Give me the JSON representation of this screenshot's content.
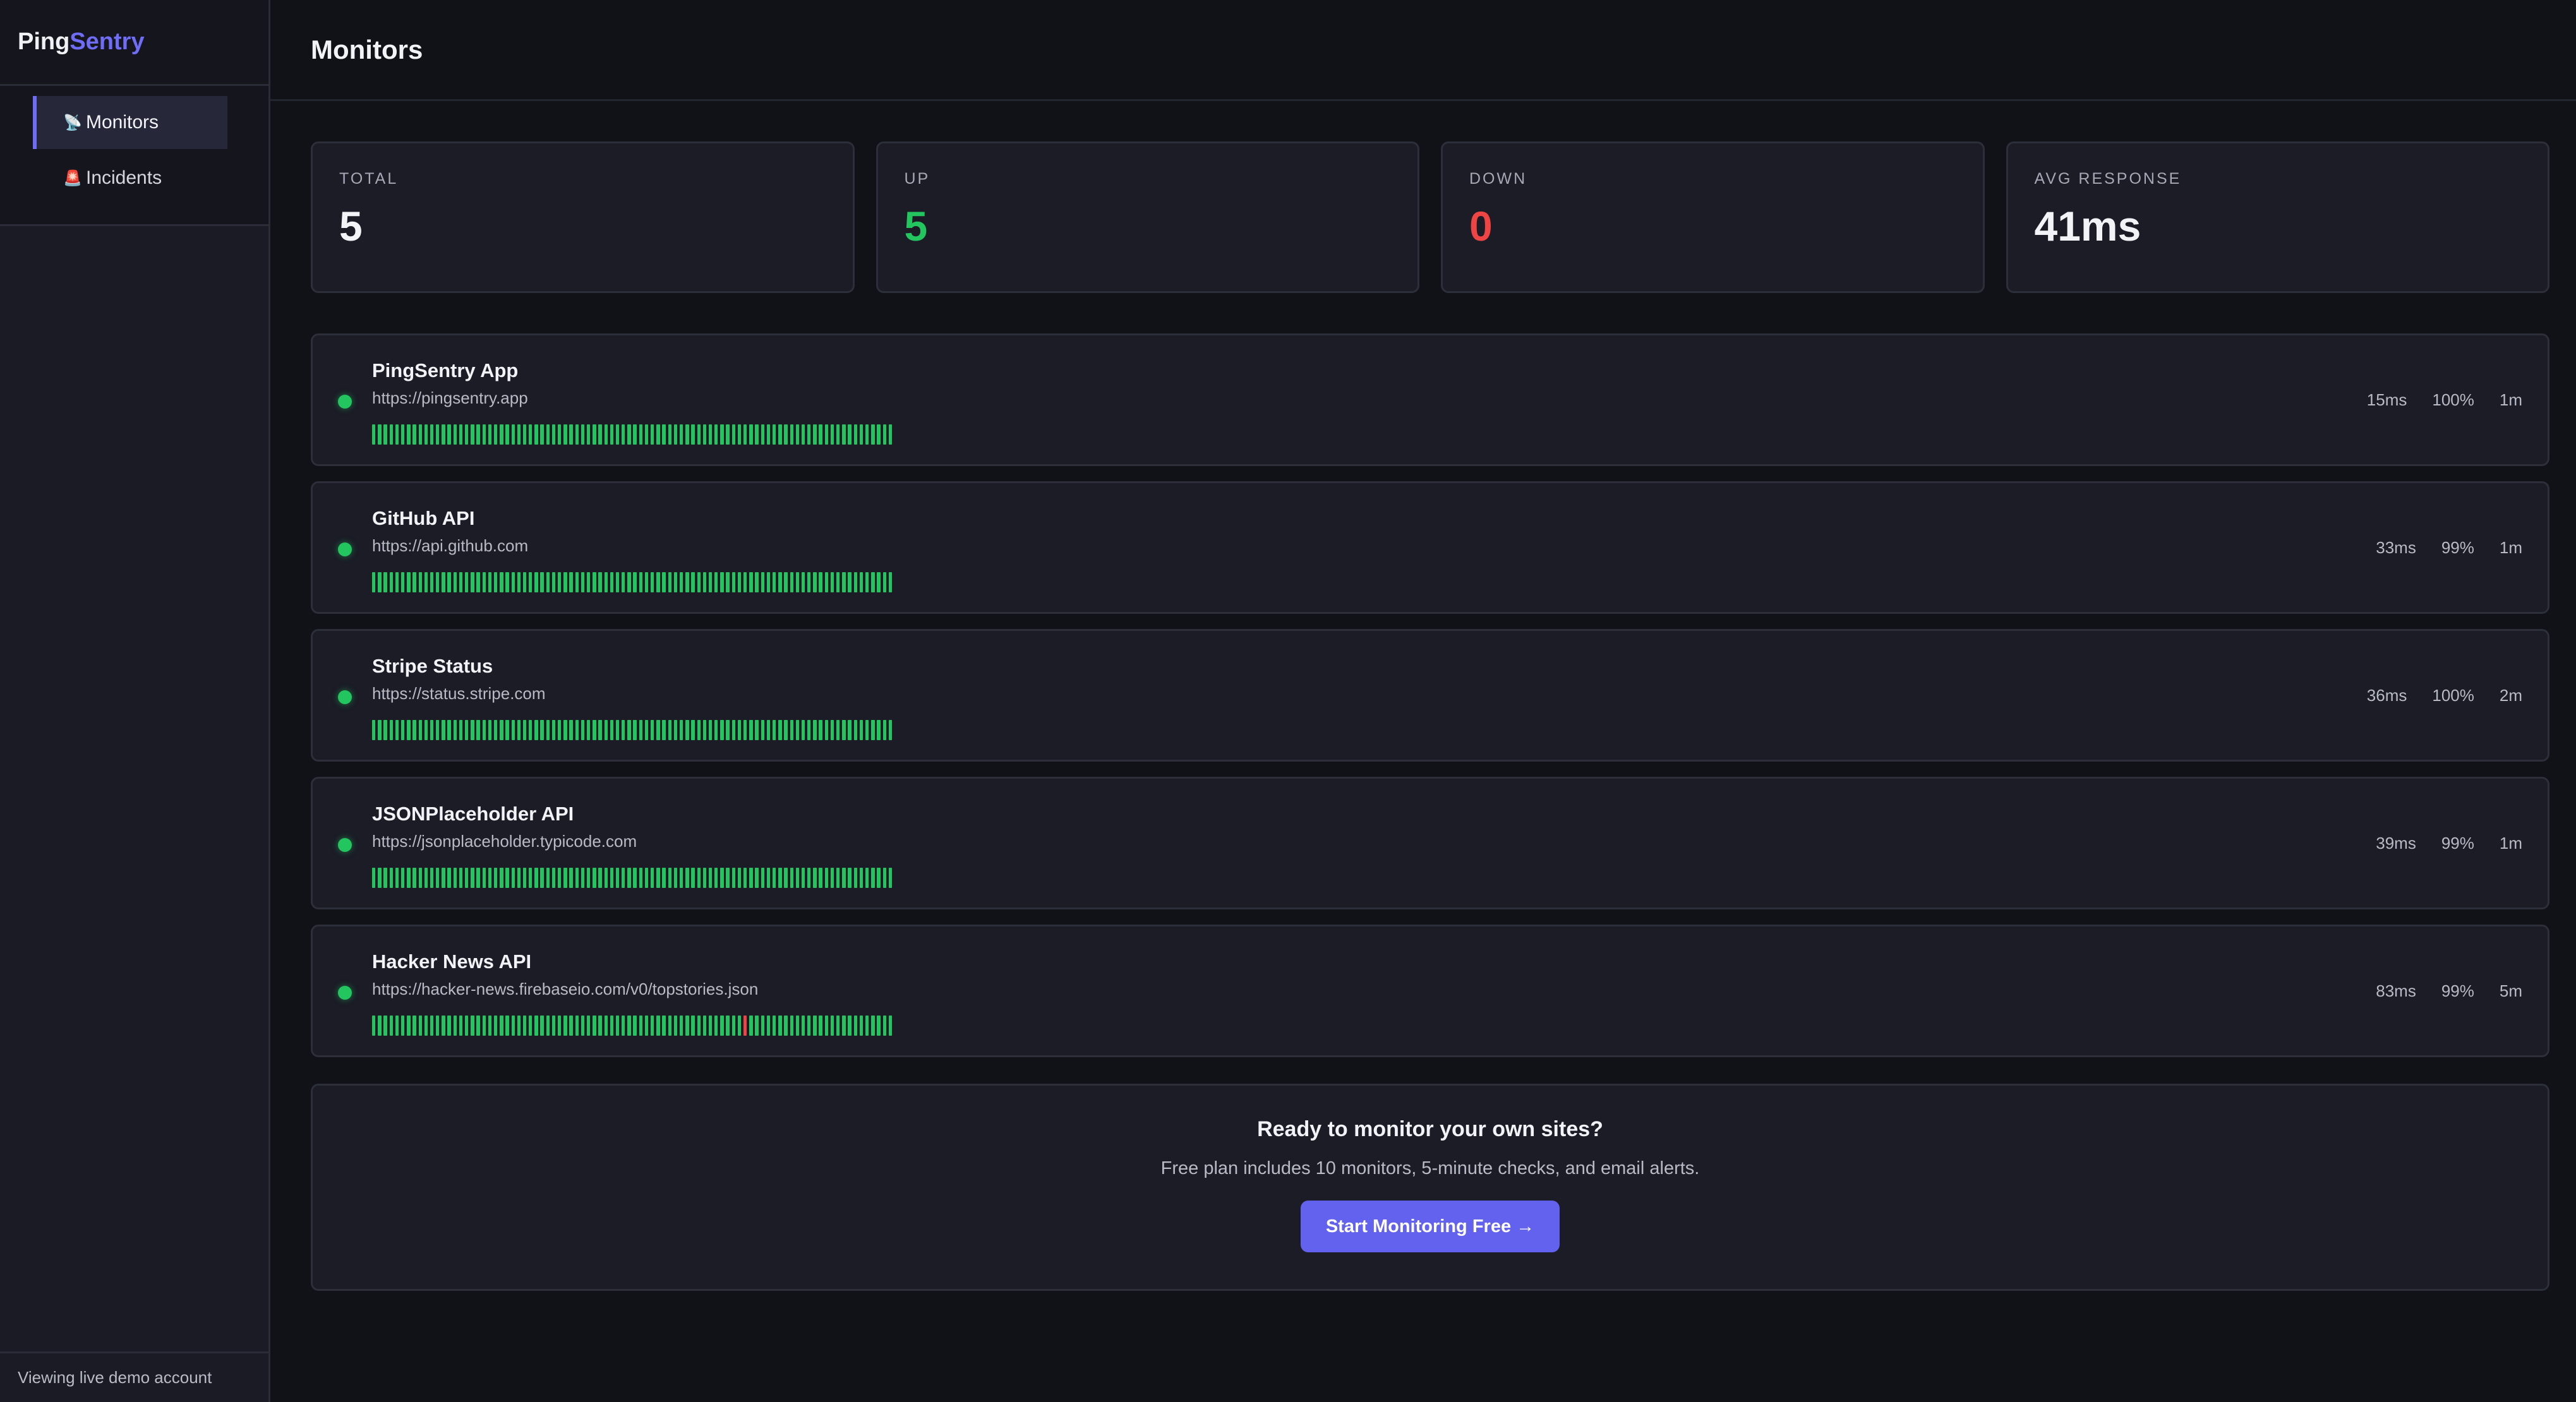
{
  "brand": {
    "part1": "Ping",
    "part2": "Sentry"
  },
  "nav": [
    {
      "icon": "📡",
      "icon_name": "satellite-antenna-icon",
      "label": "Monitors",
      "active": true
    },
    {
      "icon": "🚨",
      "icon_name": "siren-icon",
      "label": "Incidents",
      "active": false
    }
  ],
  "footer_text": "Viewing live demo account",
  "page_title": "Monitors",
  "stats": [
    {
      "label": "TOTAL",
      "value": "5",
      "tone": "default"
    },
    {
      "label": "UP",
      "value": "5",
      "tone": "green"
    },
    {
      "label": "DOWN",
      "value": "0",
      "tone": "red"
    },
    {
      "label": "AVG RESPONSE",
      "value": "41ms",
      "tone": "default"
    }
  ],
  "monitors": [
    {
      "name": "PingSentry App",
      "url": "https://pingsentry.app",
      "response": "15ms",
      "uptime": "100%",
      "interval": "1m",
      "status": "up",
      "down_checks": []
    },
    {
      "name": "GitHub API",
      "url": "https://api.github.com",
      "response": "33ms",
      "uptime": "99%",
      "interval": "1m",
      "status": "up",
      "down_checks": []
    },
    {
      "name": "Stripe Status",
      "url": "https://status.stripe.com",
      "response": "36ms",
      "uptime": "100%",
      "interval": "2m",
      "status": "up",
      "down_checks": []
    },
    {
      "name": "JSONPlaceholder API",
      "url": "https://jsonplaceholder.typicode.com",
      "response": "39ms",
      "uptime": "99%",
      "interval": "1m",
      "status": "up",
      "down_checks": []
    },
    {
      "name": "Hacker News API",
      "url": "https://hacker-news.firebaseio.com/v0/topstories.json",
      "response": "83ms",
      "uptime": "99%",
      "interval": "5m",
      "status": "up",
      "down_checks": [
        64
      ]
    }
  ],
  "checks_per_monitor": 90,
  "cta": {
    "title": "Ready to monitor your own sites?",
    "text": "Free plan includes 10 monitors, 5-minute checks, and email alerts.",
    "button": "Start Monitoring Free →"
  },
  "colors": {
    "accent": "#6f6cf5",
    "up": "#22c55e",
    "down": "#ef4444",
    "background": "#111217",
    "card": "#1b1c26"
  }
}
